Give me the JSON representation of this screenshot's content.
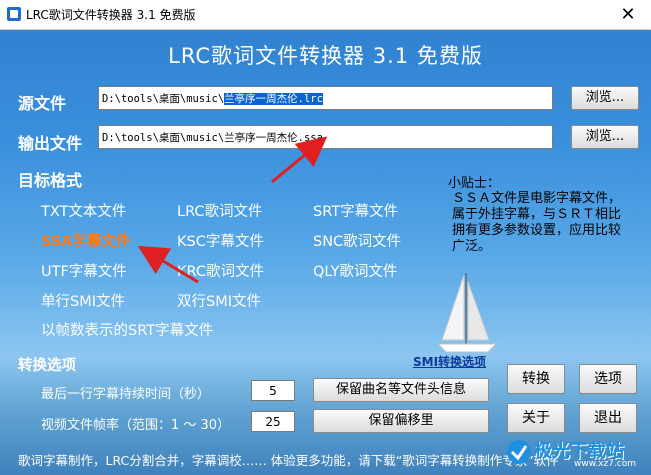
{
  "window": {
    "title": "LRC歌词文件转换器 3.1 免费版",
    "close_glyph": "✕"
  },
  "banner": "LRC歌词文件转换器 3.1 免费版",
  "source": {
    "label": "源文件",
    "value_prefix": "D:\\tools\\桌面\\music\\",
    "value_selected": "兰亭序一周杰伦.lrc",
    "browse": "浏览..."
  },
  "output": {
    "label": "输出文件",
    "value": "D:\\tools\\桌面\\music\\兰亭序一周杰伦.ssa",
    "browse": "浏览..."
  },
  "target": {
    "label": "目标格式",
    "formats": [
      "TXT文本文件",
      "LRC歌词文件",
      "SRT字幕文件",
      "SSA字幕文件",
      "KSC字幕文件",
      "SNC歌词文件",
      "UTF字幕文件",
      "KRC歌词文件",
      "QLY歌词文件",
      "单行SMI文件",
      "双行SMI文件",
      "以帧数表示的SRT字幕文件"
    ],
    "selected": "SSA字幕文件"
  },
  "tip": {
    "title": "小贴士：",
    "body": "ＳＳＡ文件是电影字幕文件，属于外挂字幕，与ＳＲＴ相比拥有更多参数设置，应用比较广泛。"
  },
  "options": {
    "label": "转换选项",
    "smi_link": "SMI转换选项",
    "last_line_label": "最后一行字幕持续时间（秒）",
    "last_line_value": "5",
    "keep_header": "保留曲名等文件头信息",
    "fps_label": "视频文件帧率（范围：1 ～ 30）",
    "fps_value": "25",
    "keep_offset": "保留偏移里"
  },
  "actions": {
    "convert": "转换",
    "options": "选项",
    "about": "关于",
    "exit": "退出"
  },
  "status": "歌词字幕制作，LRC分割合并，字幕调校…… 体验更多功能，请下载“歌词字幕转换制作专家”软件",
  "watermark": {
    "main": "极光下载站",
    "sub": "www.xz7.com"
  },
  "colors": {
    "selected_format": "#ff7a18",
    "arrow": "#e02020",
    "selection": "#0a64d0"
  }
}
